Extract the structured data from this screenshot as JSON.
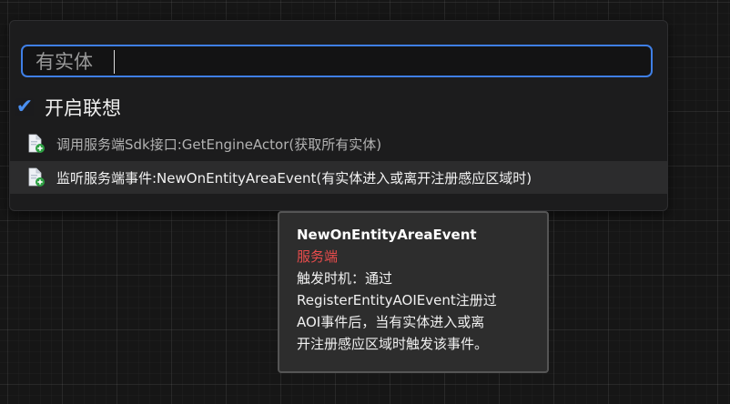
{
  "search": {
    "value": "有实体",
    "placeholder": ""
  },
  "option": {
    "checked": true,
    "label": "开启联想"
  },
  "results": [
    {
      "icon": "file-add-icon",
      "text": "调用服务端Sdk接口:GetEngineActor(获取所有实体)"
    },
    {
      "icon": "file-add-icon",
      "text": "监听服务端事件:NewOnEntityAreaEvent(有实体进入或离开注册感应区域时)"
    }
  ],
  "tooltip": {
    "title": "NewOnEntityAreaEvent",
    "side": "服务端",
    "lines": [
      "触发时机：通过",
      "RegisterEntityAOIEvent注册过",
      "AOI事件后，当有实体进入或离",
      "开注册感应区域时触发该事件。"
    ]
  },
  "colors": {
    "accent": "#3f7fe6",
    "server_side": "#e84c4c",
    "icon_green": "#2ea043"
  }
}
